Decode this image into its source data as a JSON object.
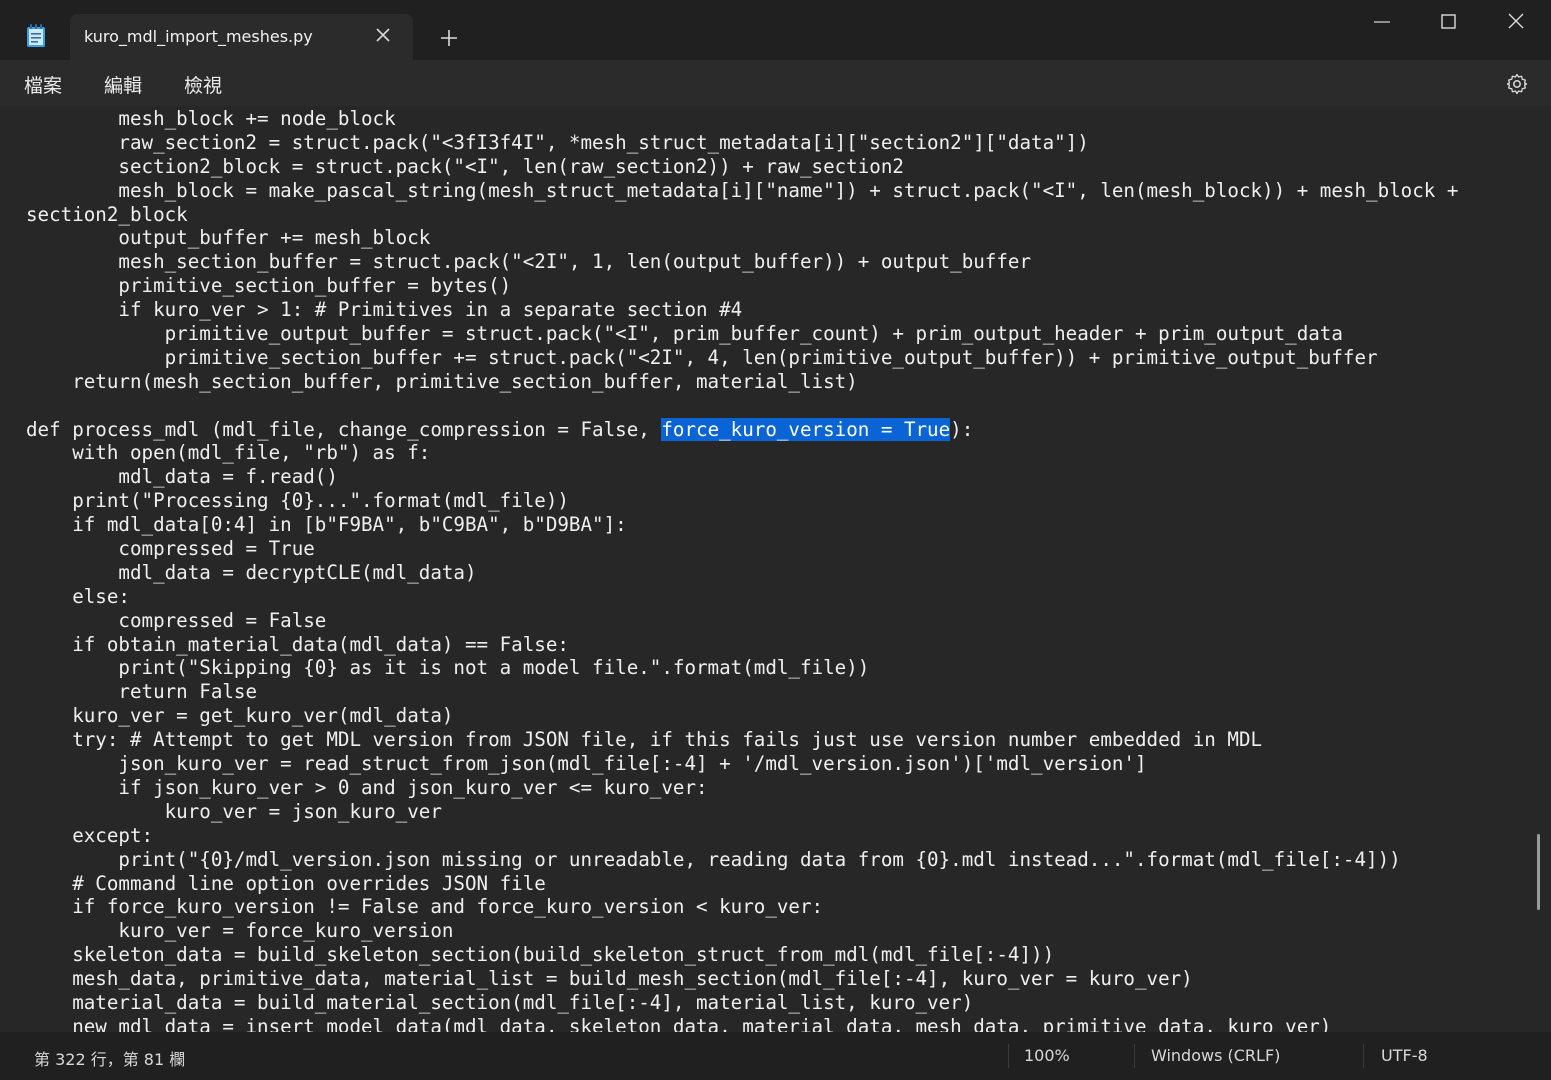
{
  "window": {
    "tab_title": "kuro_mdl_import_meshes.py",
    "new_tab_symbol": "+"
  },
  "menu": {
    "file": "檔案",
    "edit": "編輯",
    "view": "檢視"
  },
  "icons": {
    "app": "notepad-icon",
    "tab_close": "close-icon",
    "new_tab": "plus-icon",
    "minimize": "minimize-icon",
    "maximize": "maximize-icon",
    "close": "close-icon",
    "settings": "gear-icon"
  },
  "colors": {
    "selection": "#0a64d6",
    "background": "#272727"
  },
  "editor": {
    "selected_text": "force_kuro_version = True",
    "lines": [
      "        mesh_block += node_block",
      "        raw_section2 = struct.pack(\"<3fI3f4I\", *mesh_struct_metadata[i][\"section2\"][\"data\"])",
      "        section2_block = struct.pack(\"<I\", len(raw_section2)) + raw_section2",
      "        mesh_block = make_pascal_string(mesh_struct_metadata[i][\"name\"]) + struct.pack(\"<I\", len(mesh_block)) + mesh_block +",
      "section2_block",
      "        output_buffer += mesh_block",
      "        mesh_section_buffer = struct.pack(\"<2I\", 1, len(output_buffer)) + output_buffer",
      "        primitive_section_buffer = bytes()",
      "        if kuro_ver > 1: # Primitives in a separate section #4",
      "            primitive_output_buffer = struct.pack(\"<I\", prim_buffer_count) + prim_output_header + prim_output_data",
      "            primitive_section_buffer += struct.pack(\"<2I\", 4, len(primitive_output_buffer)) + primitive_output_buffer",
      "    return(mesh_section_buffer, primitive_section_buffer, material_list)",
      "",
      "def process_mdl (mdl_file, change_compression = False, ",
      "    with open(mdl_file, \"rb\") as f:",
      "        mdl_data = f.read()",
      "    print(\"Processing {0}...\".format(mdl_file))",
      "    if mdl_data[0:4] in [b\"F9BA\", b\"C9BA\", b\"D9BA\"]:",
      "        compressed = True",
      "        mdl_data = decryptCLE(mdl_data)",
      "    else:",
      "        compressed = False",
      "    if obtain_material_data(mdl_data) == False:",
      "        print(\"Skipping {0} as it is not a model file.\".format(mdl_file))",
      "        return False",
      "    kuro_ver = get_kuro_ver(mdl_data)",
      "    try: # Attempt to get MDL version from JSON file, if this fails just use version number embedded in MDL",
      "        json_kuro_ver = read_struct_from_json(mdl_file[:-4] + '/mdl_version.json')['mdl_version']",
      "        if json_kuro_ver > 0 and json_kuro_ver <= kuro_ver:",
      "            kuro_ver = json_kuro_ver",
      "    except:",
      "        print(\"{0}/mdl_version.json missing or unreadable, reading data from {0}.mdl instead...\".format(mdl_file[:-4]))",
      "    # Command line option overrides JSON file",
      "    if force_kuro_version != False and force_kuro_version < kuro_ver:",
      "        kuro_ver = force_kuro_version",
      "    skeleton_data = build_skeleton_section(build_skeleton_struct_from_mdl(mdl_file[:-4]))",
      "    mesh_data, primitive_data, material_list = build_mesh_section(mdl_file[:-4], kuro_ver = kuro_ver)",
      "    material_data = build_material_section(mdl_file[:-4], material_list, kuro_ver)",
      "    new_mdl_data = insert_model_data(mdl_data, skeleton_data, material_data, mesh_data, primitive_data, kuro_ver)"
    ],
    "line_13_suffix": "):"
  },
  "status": {
    "position": "第 322 行，第 81 欄",
    "zoom": "100%",
    "line_ending": "Windows (CRLF)",
    "encoding": "UTF-8"
  }
}
